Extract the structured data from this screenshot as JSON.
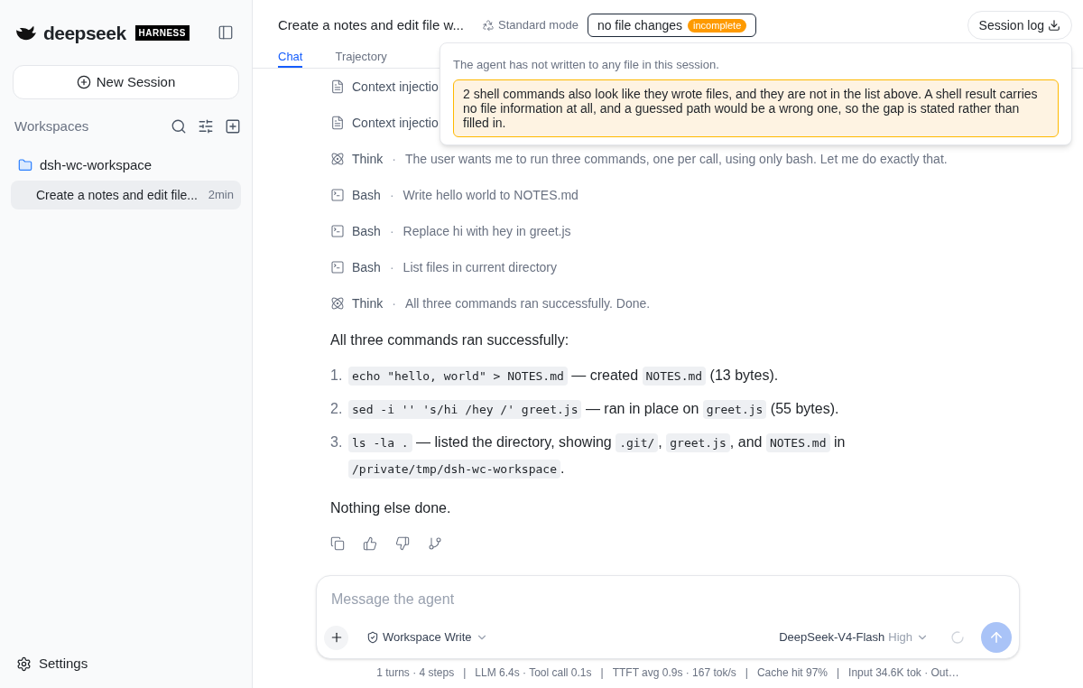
{
  "sidebar": {
    "brand": "deepseek",
    "brand_badge": "HARNESS",
    "new_session": "New Session",
    "workspaces_label": "Workspaces",
    "workspaces": [
      {
        "name": "dsh-wc-workspace",
        "children": [
          {
            "title": "Create a notes and edit file...",
            "age": "2min",
            "selected": true
          }
        ]
      }
    ],
    "settings": "Settings"
  },
  "header": {
    "title": "Create a notes and edit file w...",
    "mode": "Standard mode",
    "file_changes": "no file changes",
    "file_badge": "incomplete",
    "session_log": "Session log"
  },
  "tabs": [
    {
      "label": "Chat",
      "selected": true
    },
    {
      "label": "Trajectory",
      "selected": false
    }
  ],
  "popover": {
    "message": "The agent has not written to any file in this session.",
    "warning": "2 shell commands also look like they wrote files, and they are not in the list above. A shell result carries no file information at all, and a guessed path would be a wrong one, so the gap is stated rather than filled in."
  },
  "step_separator": "·",
  "steps": [
    {
      "kind": "context",
      "label": "Context injectio"
    },
    {
      "kind": "context",
      "label": "Context injectio"
    },
    {
      "kind": "think",
      "label": "Think",
      "detail": "The user wants me to run three commands, one per call, using only bash. Let me do exactly that."
    },
    {
      "kind": "bash",
      "label": "Bash",
      "detail": "Write hello world to NOTES.md"
    },
    {
      "kind": "bash",
      "label": "Bash",
      "detail": "Replace hi with hey in greet.js"
    },
    {
      "kind": "bash",
      "label": "Bash",
      "detail": "List files in current directory"
    },
    {
      "kind": "think",
      "label": "Think",
      "detail": "All three commands ran successfully. Done."
    }
  ],
  "answer": {
    "intro": "All three commands ran successfully:",
    "items": [
      {
        "number": "1.",
        "parts": [
          {
            "kind": "code",
            "text": "echo \"hello, world\" > NOTES.md"
          },
          {
            "kind": "text",
            "text": " — created "
          },
          {
            "kind": "code",
            "text": "NOTES.md"
          },
          {
            "kind": "text",
            "text": " (13 bytes)."
          }
        ]
      },
      {
        "number": "2.",
        "parts": [
          {
            "kind": "code",
            "text": "sed -i '' 's/hi /hey /' greet.js"
          },
          {
            "kind": "text",
            "text": " — ran in place on "
          },
          {
            "kind": "code",
            "text": "greet.js"
          },
          {
            "kind": "text",
            "text": " (55 bytes)."
          }
        ]
      },
      {
        "number": "3.",
        "parts": [
          {
            "kind": "code",
            "text": "ls -la ."
          },
          {
            "kind": "text",
            "text": " — listed the directory, showing "
          },
          {
            "kind": "code",
            "text": ".git/"
          },
          {
            "kind": "text",
            "text": ", "
          },
          {
            "kind": "code",
            "text": "greet.js"
          },
          {
            "kind": "text",
            "text": ", and "
          },
          {
            "kind": "code",
            "text": "NOTES.md"
          },
          {
            "kind": "text",
            "text": " in "
          },
          {
            "kind": "code",
            "text": "/private/tmp/dsh-wc-workspace"
          },
          {
            "kind": "text",
            "text": "."
          }
        ]
      }
    ],
    "outro": "Nothing else done."
  },
  "composer": {
    "placeholder": "Message the agent",
    "permission": "Workspace Write",
    "model": "DeepSeek-V4-Flash",
    "effort": "High"
  },
  "stats": {
    "separator": "|",
    "items": [
      "1 turns · 4 steps",
      "LLM 6.4s · Tool call 0.1s",
      "TTFT avg 0.9s · 167 tok/s",
      "Cache hit 97%",
      "Input 34.6K tok · Out…"
    ]
  }
}
